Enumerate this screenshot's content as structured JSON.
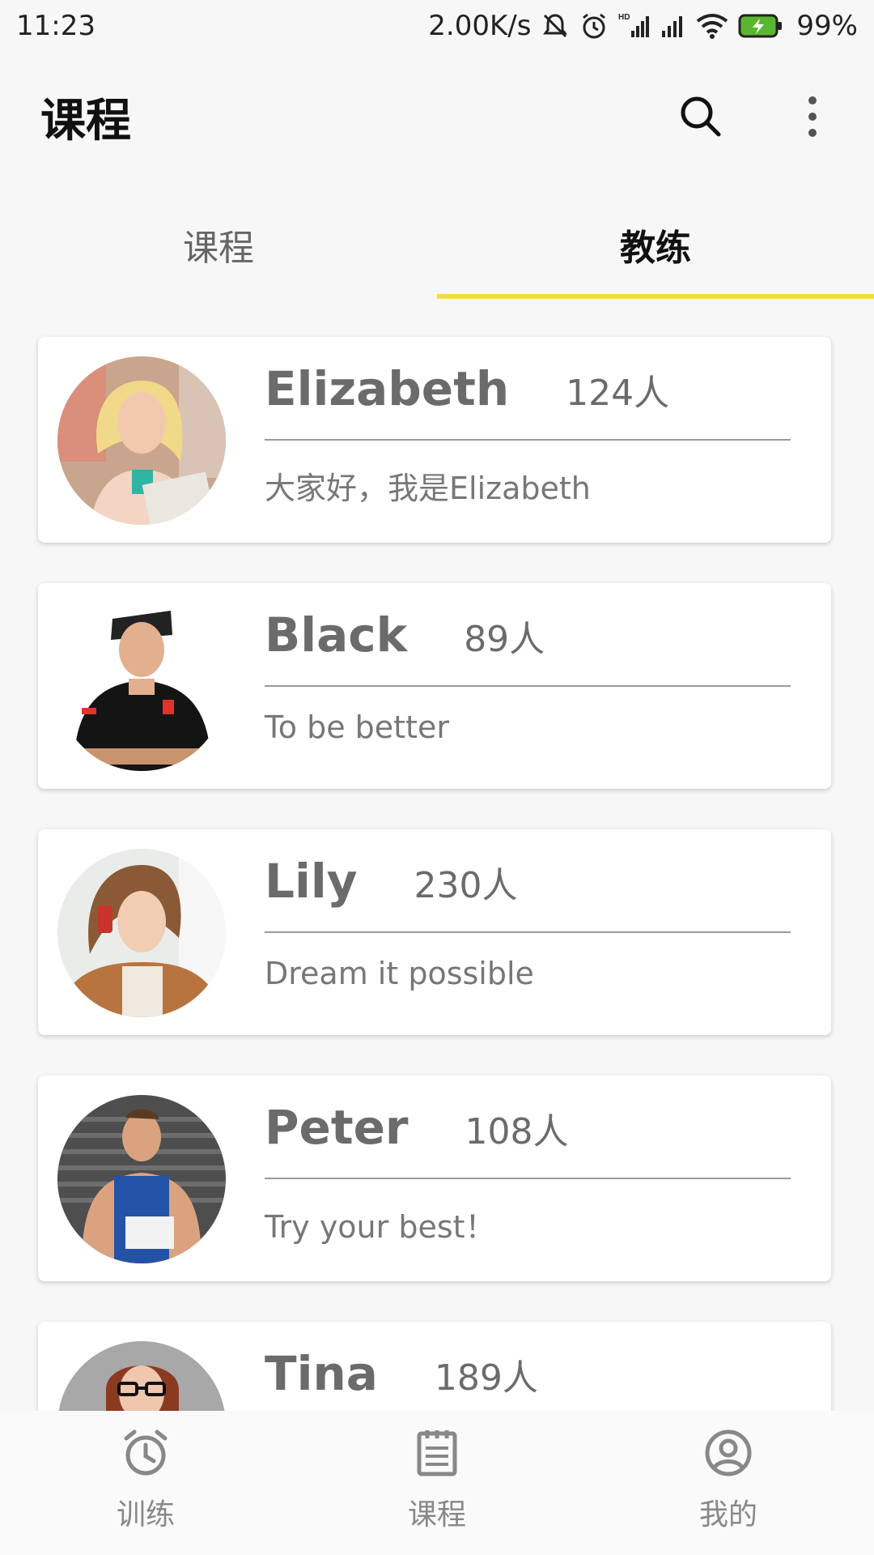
{
  "status_bar": {
    "time": "11:23",
    "net_speed": "2.00K/s",
    "battery": "99%"
  },
  "app_bar": {
    "title": "课程",
    "actions": [
      "search-icon",
      "more-vert-icon"
    ]
  },
  "tabs": [
    {
      "label": "课程",
      "active": false
    },
    {
      "label": "教练",
      "active": true
    }
  ],
  "accent_color": "#f5dc3d",
  "coaches": [
    {
      "name": "Elizabeth",
      "count": "124人",
      "motto": "大家好，我是Elizabeth"
    },
    {
      "name": "Black",
      "count": "89人",
      "motto": "To be better"
    },
    {
      "name": "Lily",
      "count": "230人",
      "motto": "Dream it possible"
    },
    {
      "name": "Peter",
      "count": "108人",
      "motto": "Try your best！"
    },
    {
      "name": "Tina",
      "count": "189人",
      "motto": ""
    }
  ],
  "bottom_nav": [
    {
      "label": "训练",
      "icon": "alarm-clock-icon"
    },
    {
      "label": "课程",
      "icon": "document-list-icon"
    },
    {
      "label": "我的",
      "icon": "user-profile-icon"
    }
  ]
}
